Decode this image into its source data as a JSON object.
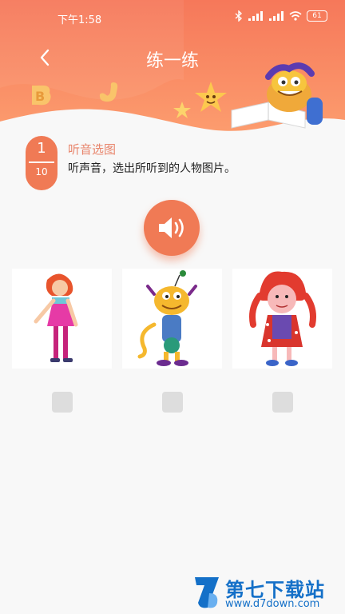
{
  "status_bar": {
    "time": "下午1:58",
    "battery": "61"
  },
  "header": {
    "title": "练一练"
  },
  "question": {
    "current": "1",
    "total": "10",
    "type_label": "听音选图",
    "instruction": "听声音，选出所听到的人物图片。"
  },
  "options": [
    {
      "name": "girl-pink-dress"
    },
    {
      "name": "monster-character"
    },
    {
      "name": "girl-red-pigtails"
    }
  ],
  "colors": {
    "accent": "#f07a55",
    "header_top": "#f6785a",
    "header_bottom": "#fb9a6c",
    "title_pink": "#e8856c"
  },
  "watermark": {
    "text": "第七下载站",
    "url": "www.d7down.com"
  }
}
